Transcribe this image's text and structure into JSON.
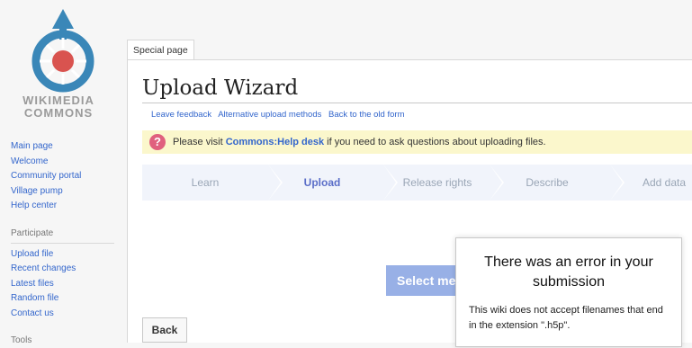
{
  "logo": {
    "line1": "WIKIMEDIA",
    "line2": "COMMONS"
  },
  "sidebar": {
    "nav": [
      "Main page",
      "Welcome",
      "Community portal",
      "Village pump",
      "Help center"
    ],
    "participate_heading": "Participate",
    "participate": [
      "Upload file",
      "Recent changes",
      "Latest files",
      "Random file",
      "Contact us"
    ],
    "tools_heading": "Tools"
  },
  "tab": {
    "label": "Special page"
  },
  "page": {
    "title": "Upload Wizard",
    "links": [
      "Leave feedback",
      "Alternative upload methods",
      "Back to the old form"
    ]
  },
  "notice": {
    "prefix": "Please visit ",
    "link": "Commons:Help desk",
    "suffix": " if you need to ask questions about uploading files."
  },
  "steps": [
    "Learn",
    "Upload",
    "Release rights",
    "Describe",
    "Add data"
  ],
  "active_step": "Upload",
  "buttons": {
    "select": "Select media",
    "back": "Back"
  },
  "error": {
    "title": "There was an error in your submission",
    "message": "This wiki does not accept filenames that end in the extension \".h5p\"."
  },
  "colors": {
    "link": "#3366cc",
    "notice_bg": "#fbf7cc",
    "step_bg": "#f1f4fb",
    "active_step": "#5b6ec8",
    "select_btn": "#98b0e6"
  }
}
